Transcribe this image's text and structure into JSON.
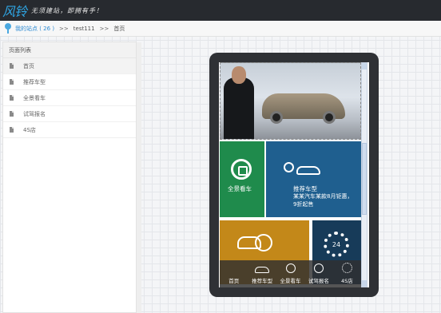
{
  "header": {
    "logo": "风铃",
    "slogan": "无须建站，即拥有手！"
  },
  "breadcrumb": {
    "site_link": "我的站点 ( 26 )",
    "sep1": ">>",
    "site_name": "test111",
    "sep2": ">>",
    "current": "首页"
  },
  "sidebar": {
    "title": "页面列表",
    "items": [
      {
        "label": "首页"
      },
      {
        "label": "推荐车型"
      },
      {
        "label": "全景看车"
      },
      {
        "label": "试驾报名"
      },
      {
        "label": "4S店"
      }
    ]
  },
  "phone": {
    "tiles": {
      "green_label": "全景看车",
      "blue_title": "推荐车型",
      "blue_desc1": "某某汽车某款8月钜惠，",
      "blue_desc2": "9折起售",
      "navy_icon_text": "24"
    },
    "tabs": [
      {
        "label": "首页",
        "icon": "home-icon"
      },
      {
        "label": "推荐车型",
        "icon": "car-icon"
      },
      {
        "label": "全景看车",
        "icon": "refresh-icon"
      },
      {
        "label": "试驾报名",
        "icon": "car-check-icon"
      },
      {
        "label": "4S店",
        "icon": "gear-icon"
      }
    ]
  },
  "colors": {
    "topbar": "#272a2f",
    "accent": "#2fa7e6",
    "tile_green": "#1f8b4c",
    "tile_blue": "#1f5f8f",
    "tile_orange": "#c38819",
    "tile_navy": "#173b59"
  }
}
